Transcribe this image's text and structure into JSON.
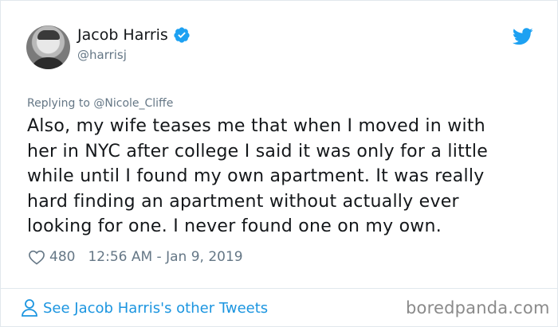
{
  "tweet": {
    "display_name": "Jacob Harris",
    "handle": "@harrisj",
    "replying_to": "Replying to @Nicole_Cliffe",
    "text_lines": [
      "Also, my wife teases me that when I moved in with",
      "her in NYC after college I said it was only for a little",
      "while until I found my own apartment. It was really",
      "hard finding an apartment without actually ever",
      "looking for one. I never found one on my own."
    ],
    "likes": "480",
    "timestamp": "12:56 AM - Jan 9, 2019"
  },
  "footer": {
    "link_label": "See Jacob Harris's other Tweets"
  },
  "watermark": "boredpanda.com",
  "icons": {
    "verified": "verified-badge-icon",
    "twitter": "twitter-bird-icon",
    "like": "heart-icon",
    "profile": "user-icon"
  },
  "colors": {
    "brand_blue": "#1da1f2",
    "link_blue": "#1b95e0",
    "secondary_text": "#657786",
    "primary_text": "#14171a",
    "divider": "#e1e8ed"
  }
}
